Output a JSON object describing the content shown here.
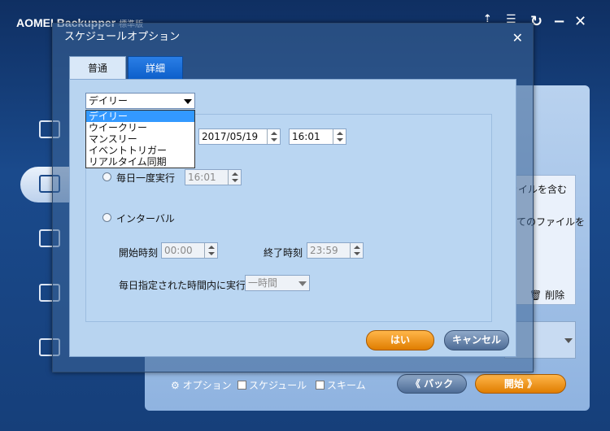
{
  "app": {
    "title": "AOMEI Backupper",
    "edition": "標準版",
    "icons": [
      "upgrade-icon",
      "menu-icon",
      "refresh-icon",
      "minimize-icon",
      "close-icon"
    ]
  },
  "main": {
    "partial_labels": [
      "ァイルを含む",
      "てのファイルを"
    ],
    "delete_label": "削除",
    "bottom": {
      "options_label": "オプション",
      "schedule_label": "スケジュール",
      "scheme_label": "スキーム",
      "back_button": "《 バック",
      "start_button": "開始 》"
    }
  },
  "dialog": {
    "title": "スケジュールオプション",
    "tabs": [
      {
        "label": "普通",
        "active": true
      },
      {
        "label": "詳細",
        "active": false
      }
    ],
    "frequency_select": {
      "value": "デイリー",
      "options": [
        "デイリー",
        "ウイークリー",
        "マンスリー",
        "イベントトリガー",
        "リアルタイム同期"
      ],
      "highlighted_index": 0
    },
    "date_value": "2017/05/19",
    "time_value": "16:01",
    "once_label": "毎日一度実行",
    "once_time": "16:01",
    "interval_label": "インターバル",
    "start_time_label": "開始時刻",
    "start_time_value": "00:00",
    "end_time_label": "終了時刻",
    "end_time_value": "23:59",
    "every_label": "毎日指定された時間内に実行",
    "every_value": "一時間",
    "ok_button": "はい",
    "cancel_button": "キャンセル"
  }
}
